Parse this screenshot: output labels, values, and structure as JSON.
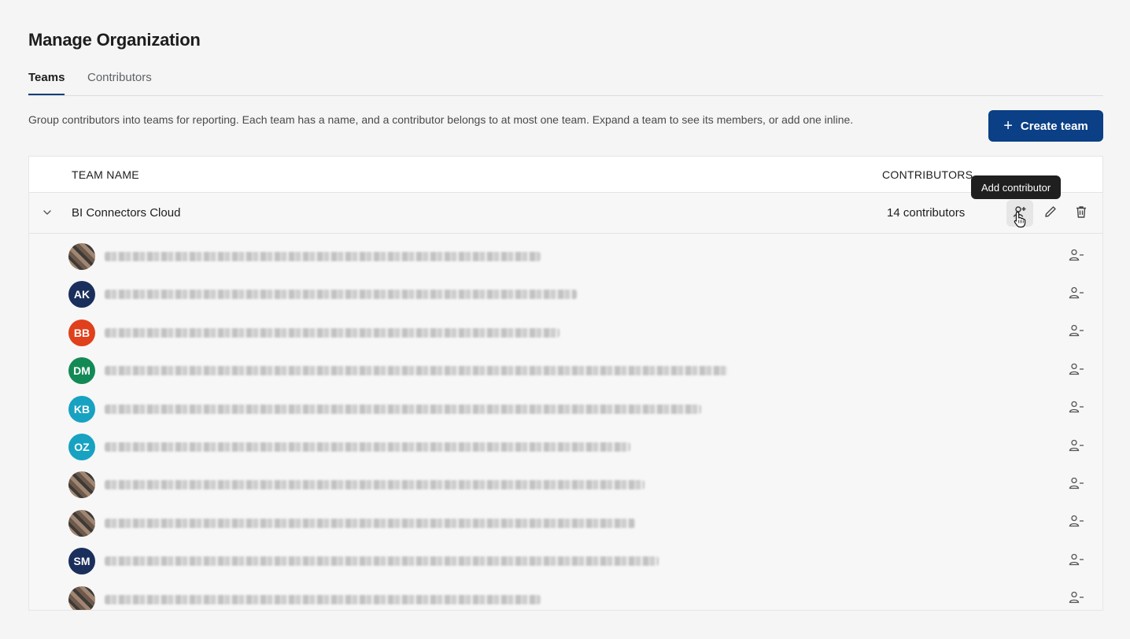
{
  "page": {
    "title": "Manage Organization"
  },
  "tabs": [
    {
      "label": "Teams",
      "active": true
    },
    {
      "label": "Contributors",
      "active": false
    }
  ],
  "description": "Group contributors into teams for reporting. Each team has a name, and a contributor belongs to at most one team. Expand a team to see its members, or add one inline.",
  "create_button": {
    "label": "Create team",
    "icon": "plus-icon"
  },
  "table": {
    "headers": {
      "team_name": "TEAM NAME",
      "contributors": "CONTRIBUTORS"
    },
    "team": {
      "name": "BI Connectors Cloud",
      "count_label": "14 contributors",
      "tooltip": "Add contributor",
      "expanded": true
    },
    "members": [
      {
        "initials": "",
        "avatar_type": "photo",
        "color": "#8b6f5a"
      },
      {
        "initials": "AK",
        "avatar_type": "initials",
        "color": "#1b2f5c"
      },
      {
        "initials": "BB",
        "avatar_type": "initials",
        "color": "#e0401b"
      },
      {
        "initials": "DM",
        "avatar_type": "initials",
        "color": "#138a56"
      },
      {
        "initials": "KB",
        "avatar_type": "initials",
        "color": "#17a2c2"
      },
      {
        "initials": "OZ",
        "avatar_type": "initials",
        "color": "#17a2c2"
      },
      {
        "initials": "",
        "avatar_type": "photo",
        "color": "#7a8a8e"
      },
      {
        "initials": "",
        "avatar_type": "photo",
        "color": "#5b3a2e"
      },
      {
        "initials": "SM",
        "avatar_type": "initials",
        "color": "#1b2f5c"
      },
      {
        "initials": "",
        "avatar_type": "photo",
        "color": "#9b7968"
      }
    ]
  },
  "colors": {
    "accent": "#0b3f86",
    "tab_underline": "#123e7c",
    "tooltip_bg": "#1f1f1f"
  }
}
